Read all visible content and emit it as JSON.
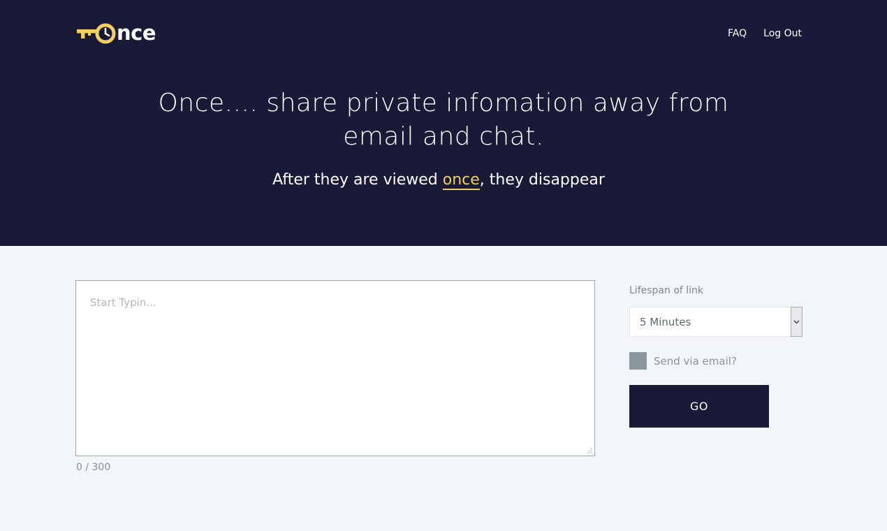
{
  "brand": {
    "name": "nce",
    "accent_color": "#f0cf5d",
    "dark_color": "#191a38"
  },
  "nav": {
    "faq": "FAQ",
    "logout": "Log Out"
  },
  "hero": {
    "headline_line1": "Once.... share private infomation away from",
    "headline_line2": "email and chat.",
    "tagline_before": "After they are viewed ",
    "tagline_highlight": "once",
    "tagline_after": ", they disappear"
  },
  "form": {
    "textarea_placeholder": "Start Typin...",
    "textarea_value": "",
    "counter": "0 / 300",
    "lifespan_label": "Lifespan of link",
    "lifespan_selected": "5 Minutes",
    "email_checkbox_label": "Send via email?",
    "email_checkbox_checked": false,
    "go_label": "GO"
  },
  "icons": {
    "logo": "key-clock-icon",
    "select_arrow": "chevron-down-icon",
    "resize": "resize-grip-icon"
  }
}
